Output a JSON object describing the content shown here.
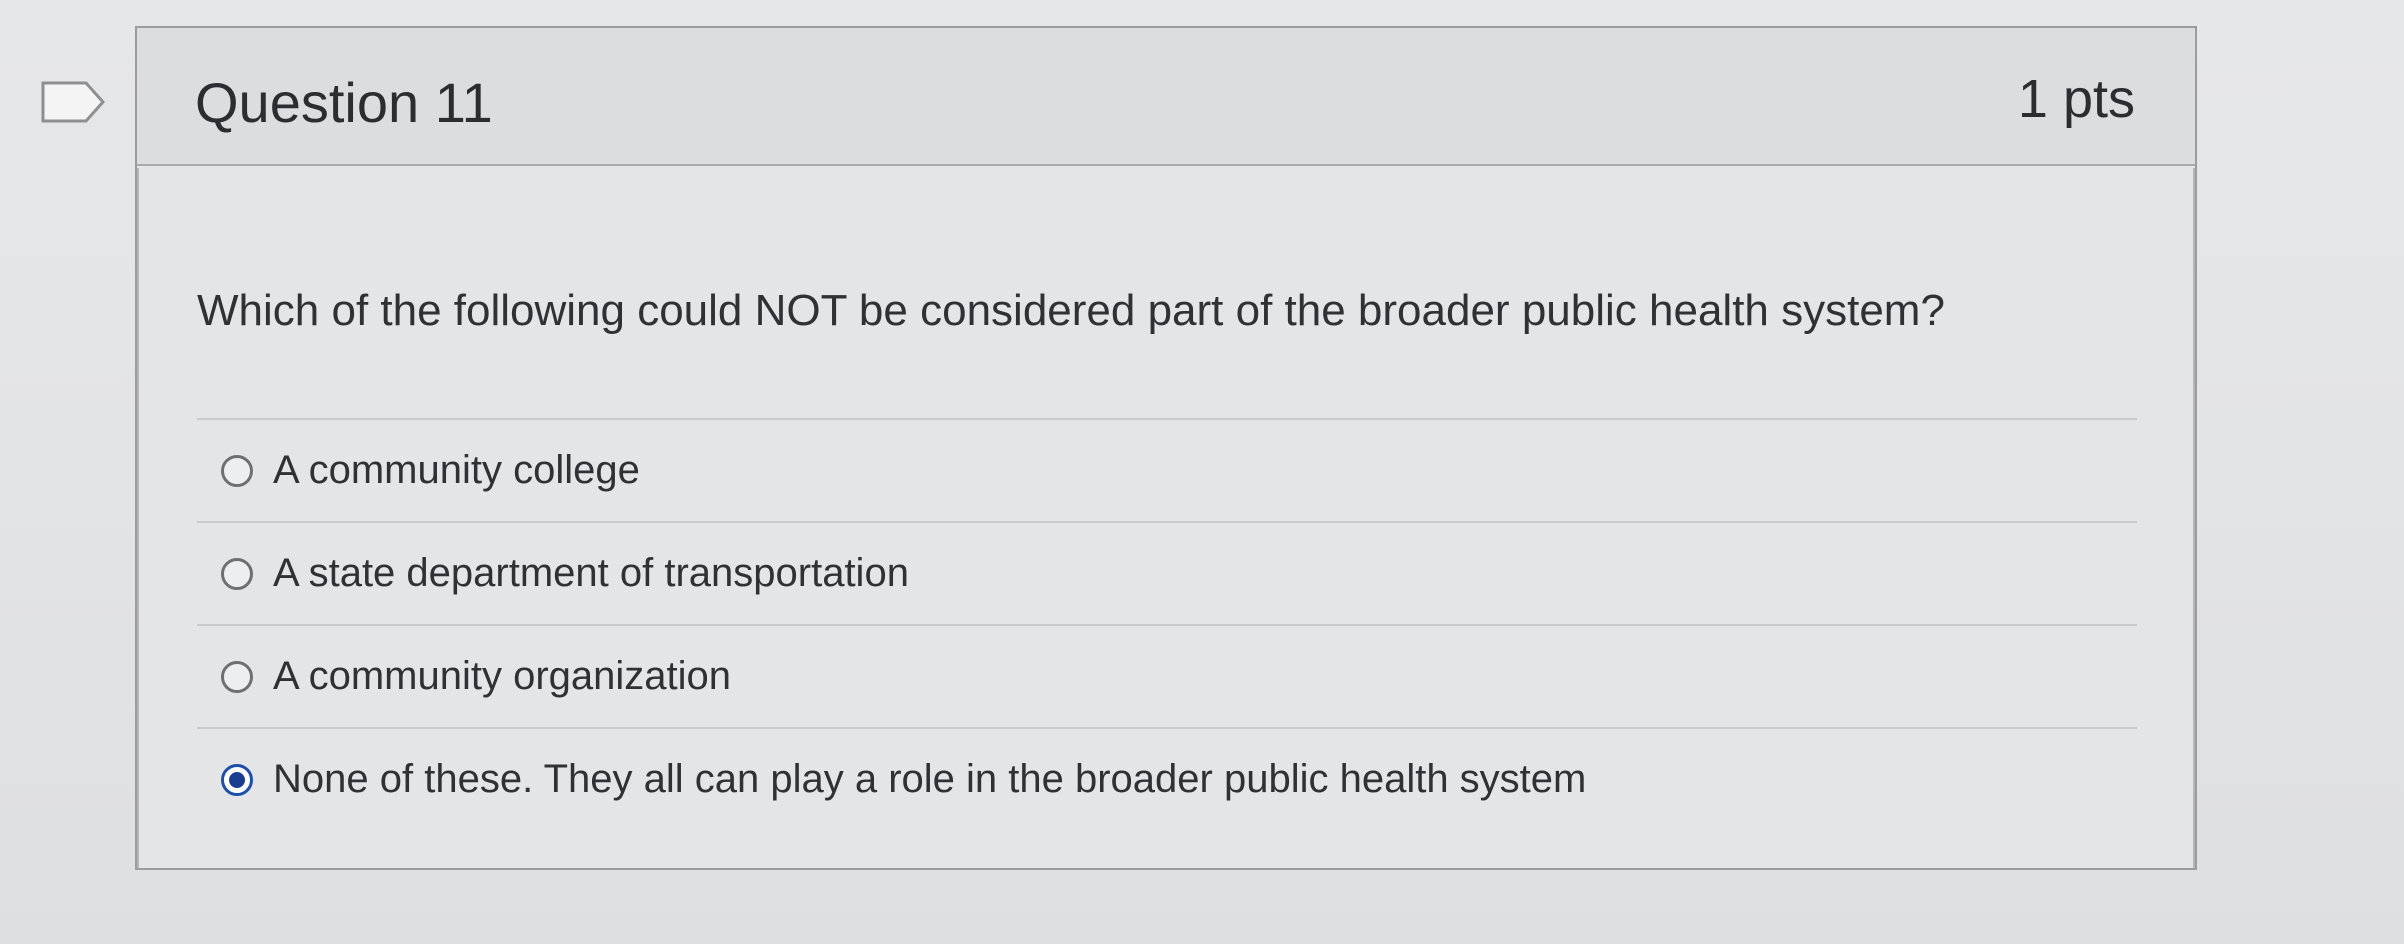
{
  "question": {
    "title": "Question 11",
    "points": "1 pts",
    "text": "Which of the following could NOT be considered part of the broader public health system?"
  },
  "answers": [
    {
      "label": "A community college",
      "selected": false
    },
    {
      "label": "A state department of transportation",
      "selected": false
    },
    {
      "label": "A community organization",
      "selected": false
    },
    {
      "label": "None of these. They all can play a role in the broader public health system",
      "selected": true
    }
  ],
  "colors": {
    "accent": "#1a3d8f"
  }
}
